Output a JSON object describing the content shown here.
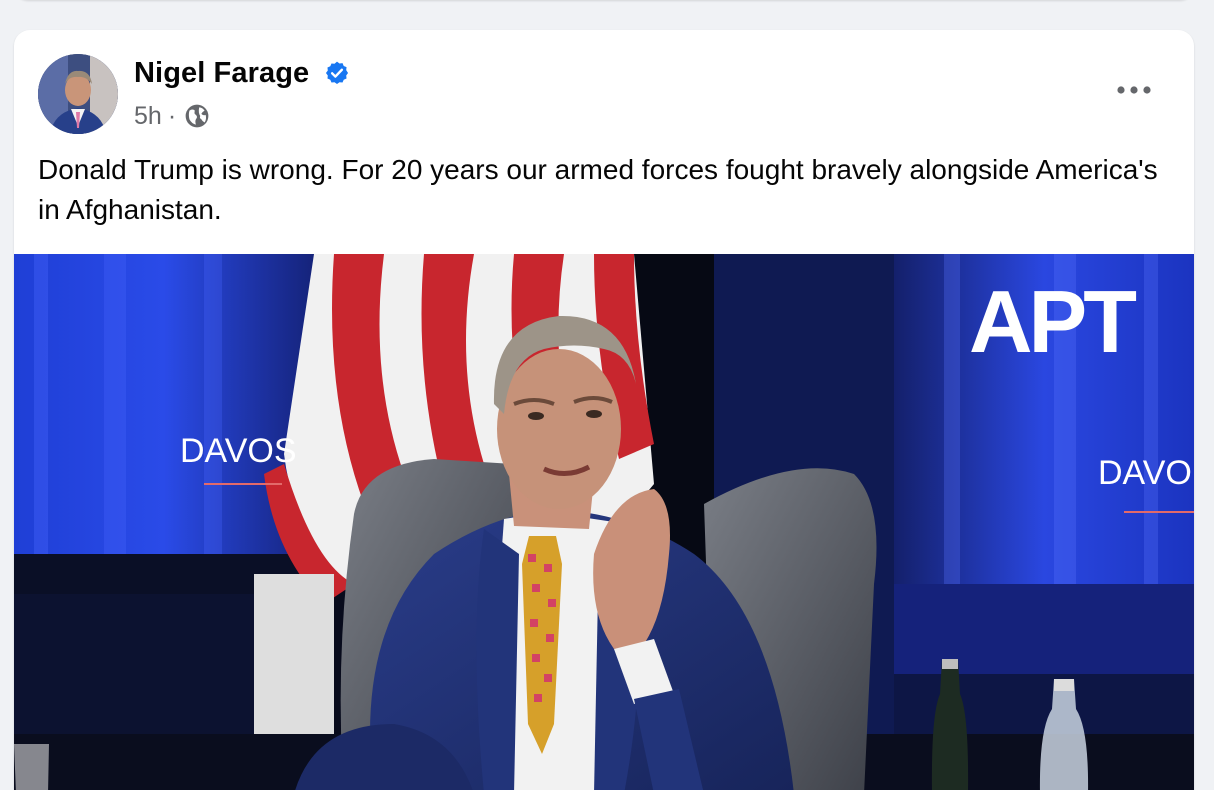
{
  "post": {
    "author": "Nigel Farage",
    "verified": true,
    "timestamp": "5h",
    "separator": "·",
    "audience_icon": "globe-icon",
    "more_icon": "more-options-icon",
    "text": "Donald Trump is wrong. For 20 years our armed forces fought bravely alongside America's in Afghanistan."
  },
  "media": {
    "type": "video-still",
    "logo_text": "APT",
    "backdrop_left_text": "DAVOS",
    "backdrop_right_text": "DAVO"
  },
  "colors": {
    "verified_blue": "#1877f2",
    "secondary_text": "#65676b",
    "primary_text": "#050505",
    "page_background": "#f0f2f5"
  }
}
